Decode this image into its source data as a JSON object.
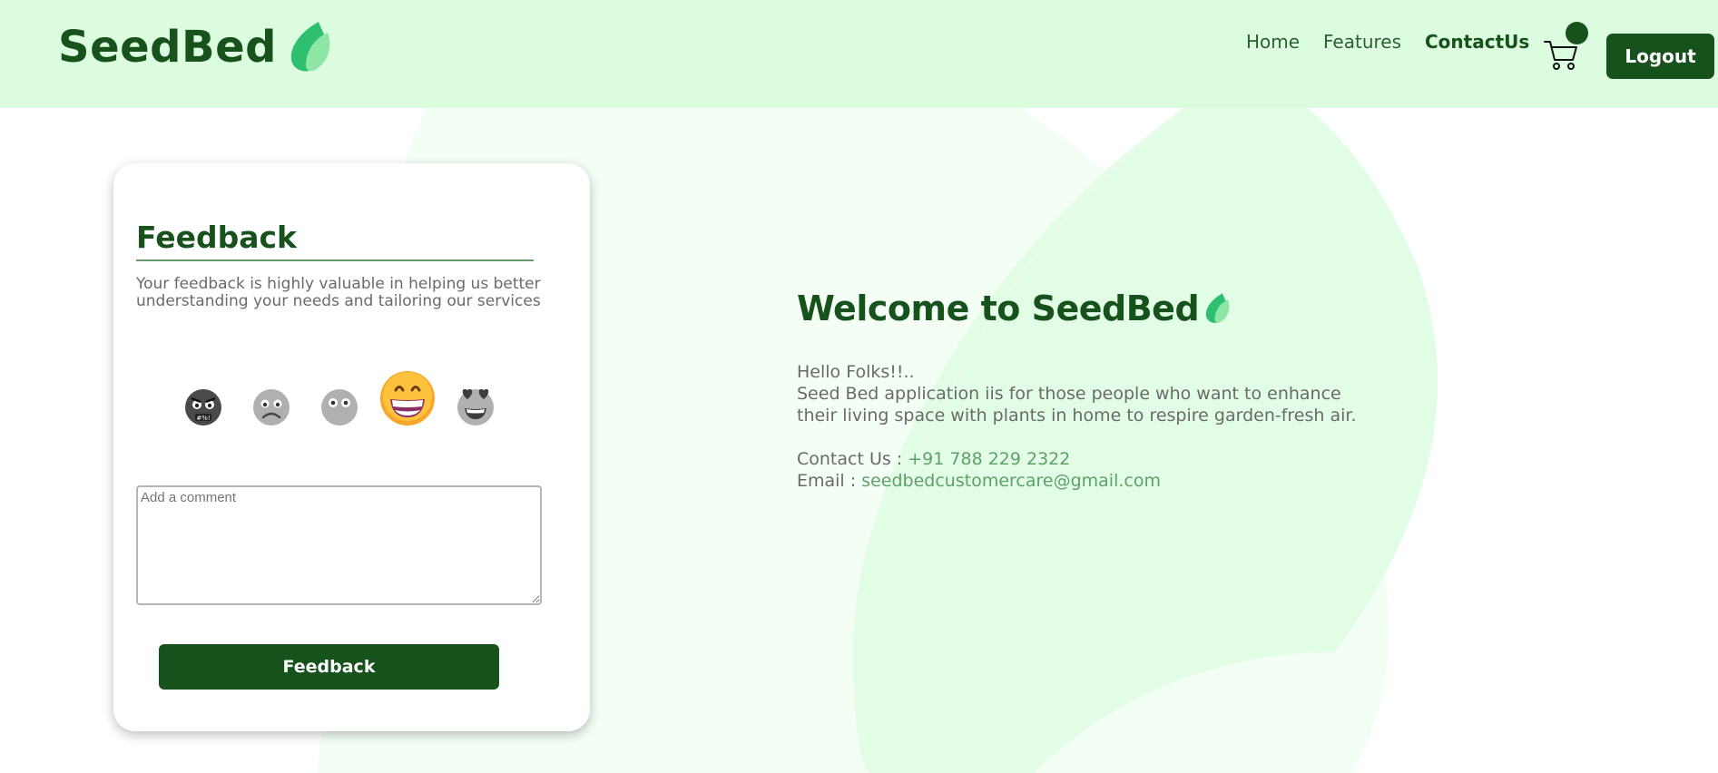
{
  "brand": {
    "name": "SeedBed",
    "icon": "leaf-icon"
  },
  "nav": {
    "home": "Home",
    "features": "Features",
    "contact": "ContactUs",
    "cart_icon": "cart-icon",
    "logout": "Logout"
  },
  "feedback": {
    "title": "Feedback",
    "description": "Your feedback is highly valuable in helping us better understanding your needs and tailoring our services",
    "emojis": [
      "angry-face-icon",
      "frowning-face-icon",
      "neutral-face-icon",
      "grinning-face-icon",
      "heart-eyes-face-icon"
    ],
    "selected_emoji": "grinning-face-icon",
    "comment_placeholder": "Add a comment",
    "submit_label": "Feedback"
  },
  "welcome": {
    "title": "Welcome to SeedBed",
    "greeting": "Hello Folks!!..",
    "text": "Seed Bed application iis for those people who want to enhance their living space with plants in home to respire garden-fresh air.",
    "contact_label": "Contact Us : ",
    "contact_value": "+91 788 229 2322",
    "email_label": "Email : ",
    "email_value": "seedbedcustomercare@gmail.com"
  },
  "colors": {
    "header_bg": "#dcfcdf",
    "primary": "#17521d",
    "accent_green": "#5f9f6a",
    "bg_blob": "#e6fde9"
  }
}
